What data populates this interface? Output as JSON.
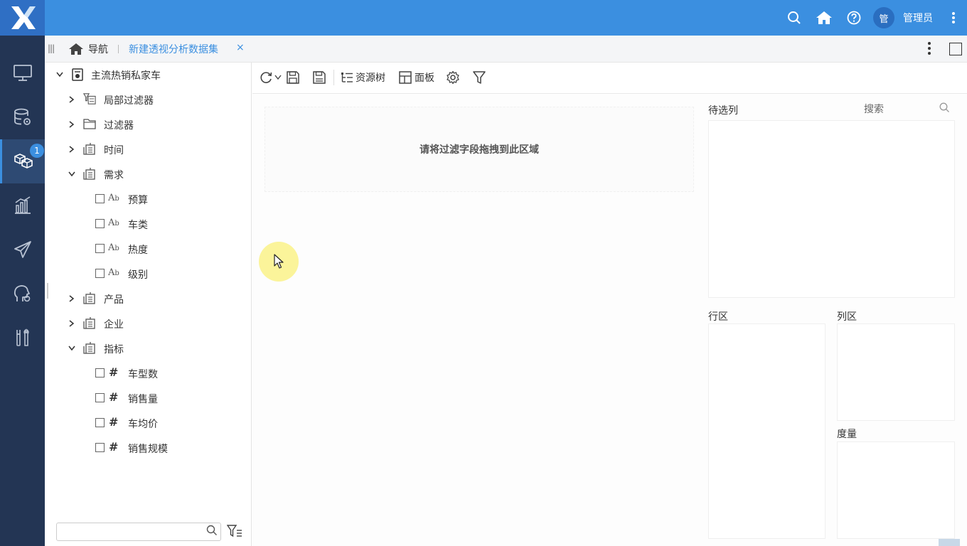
{
  "app": {
    "user_avatar": "管",
    "username": "管理员",
    "accent": "#3b8fe0",
    "sidebar_bg": "#233554"
  },
  "leftnav": {
    "items": [
      {
        "icon": "monitor-icon"
      },
      {
        "icon": "database-settings-icon"
      },
      {
        "icon": "cube-icon",
        "badge": "1",
        "active": true
      },
      {
        "icon": "bar-chart-icon"
      },
      {
        "icon": "paper-plane-icon"
      },
      {
        "icon": "brain-gear-icon"
      },
      {
        "icon": "tools-icon"
      }
    ]
  },
  "tabs": {
    "home_label": "导航",
    "active_label": "新建透视分析数据集",
    "close": "×"
  },
  "tree": {
    "root": "主流热销私家车",
    "items": [
      {
        "label": "局部过滤器"
      },
      {
        "label": "过滤器"
      },
      {
        "label": "时间"
      },
      {
        "label": "需求"
      },
      {
        "label": "预算"
      },
      {
        "label": "车类"
      },
      {
        "label": "热度"
      },
      {
        "label": "级别"
      },
      {
        "label": "产品"
      },
      {
        "label": "企业"
      },
      {
        "label": "指标"
      },
      {
        "label": "车型数"
      },
      {
        "label": "销售量"
      },
      {
        "label": "车均价"
      },
      {
        "label": "销售规模"
      }
    ],
    "search_placeholder": ""
  },
  "toolbar": {
    "resource_tree": "资源树",
    "panel": "面板"
  },
  "canvas": {
    "dropzone_hint": "请将过滤字段拖拽到此区域"
  },
  "panels": {
    "candidate_title": "待选列",
    "search_placeholder": "搜索",
    "row_title": "行区",
    "column_title": "列区",
    "measure_title": "度量"
  }
}
